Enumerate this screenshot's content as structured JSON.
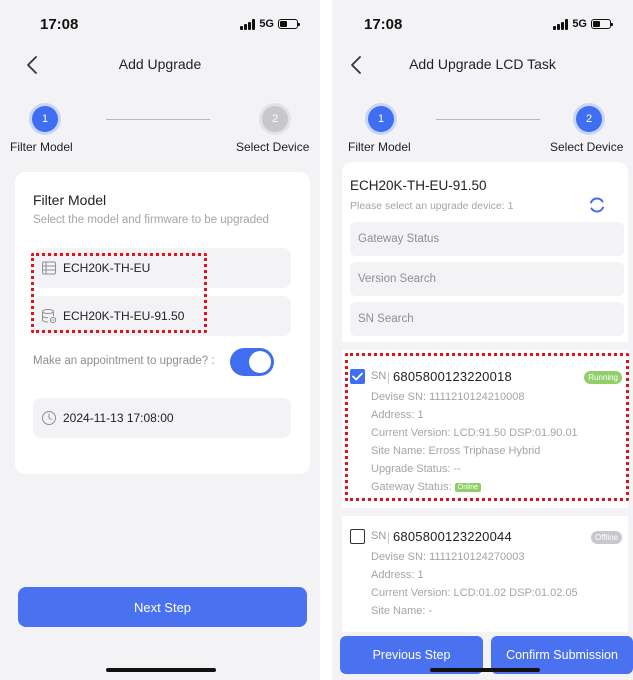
{
  "left_screen": {
    "status": {
      "time": "17:08",
      "network": "5G"
    },
    "nav": {
      "title": "Add Upgrade"
    },
    "steps": [
      {
        "number": "1",
        "label": "Filter Model"
      },
      {
        "number": "2",
        "label": "Select Device"
      }
    ],
    "card": {
      "title": "Filter Model",
      "description": "Select the model and firmware to be upgraded",
      "model_value": "ECH20K-TH-EU",
      "firmware_value": "ECH20K-TH-EU-91.50",
      "appointment_label": "Make an appointment to upgrade? :",
      "appointment_enabled": true,
      "appointment_datetime": "2024-11-13 17:08:00"
    },
    "next_button": "Next Step"
  },
  "right_screen": {
    "status": {
      "time": "17:08",
      "network": "5G"
    },
    "nav": {
      "title": "Add Upgrade LCD Task"
    },
    "steps": [
      {
        "number": "1",
        "label": "Filter Model"
      },
      {
        "number": "2",
        "label": "Select Device"
      }
    ],
    "panel": {
      "model": "ECH20K-TH-EU-91.50",
      "hint": "Please select an upgrade device: 1",
      "gateway_status_placeholder": "Gateway Status",
      "version_search_placeholder": "Version Search",
      "sn_search_placeholder": "SN Search"
    },
    "devices": [
      {
        "checked": true,
        "sn_prefix": "SN",
        "sn": "6805800123220018",
        "status": "Running",
        "device_sn": "Devise SN: 1111210124210008",
        "address": "Address: 1",
        "current_version": "Current Version: LCD:91.50 DSP:01.90.01",
        "site_name": "Site Name: Erross Triphase Hybrid",
        "upgrade_status": "Upgrade Status: --",
        "gateway_status_label": "Gateway Status:",
        "gateway_status_value": "Online"
      },
      {
        "checked": false,
        "sn_prefix": "SN",
        "sn": "6805800123220044",
        "status": "Offline",
        "device_sn": "Devise SN: 1111210124270003",
        "address": "Address: 1",
        "current_version": "Current Version: LCD:01.02 DSP:01.02.05",
        "site_name": "Site Name: -"
      }
    ],
    "buttons": {
      "previous": "Previous Step",
      "confirm": "Confirm Submission"
    }
  },
  "colors": {
    "accent": "#3f6ff0",
    "highlight": "#e0121a",
    "status_running": "#8fcf6a",
    "status_offline": "#c8c8cc",
    "background": "#f3f3f6"
  },
  "icons": [
    "signal-icon",
    "battery-icon",
    "back-icon",
    "model-list-icon",
    "firmware-database-icon",
    "clock-icon",
    "refresh-icon",
    "check-icon"
  ]
}
